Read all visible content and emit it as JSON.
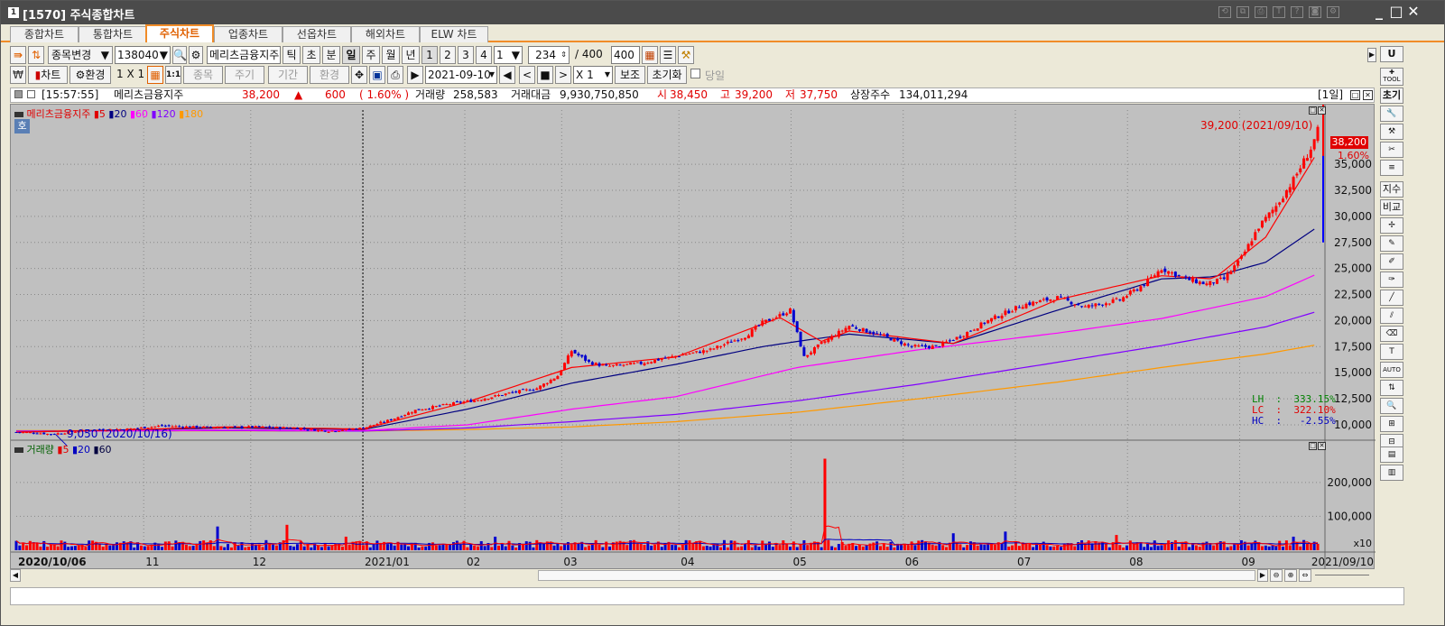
{
  "window": {
    "title": "[1570]  주식종합차트",
    "icon": "1"
  },
  "tabs": [
    "종합차트",
    "통합차트",
    "주식차트",
    "업종차트",
    "선옵차트",
    "해외차트",
    "ELW 차트"
  ],
  "active_tab": "주식차트",
  "toolbar1": {
    "stock_change": "종목변경",
    "code": "138040",
    "name": "메리츠금융지주",
    "periods": [
      "틱",
      "초",
      "분",
      "일",
      "주",
      "월",
      "년"
    ],
    "period_active": "일",
    "nums": [
      "1",
      "2",
      "3",
      "4"
    ],
    "unit_value": "1",
    "count_value": "234",
    "count_total": "/ 400",
    "count_max": "400"
  },
  "toolbar2": {
    "won": "₩",
    "chart": "차트",
    "env": "환경",
    "layout": "1 X 1",
    "stock_btn": "종목",
    "cycle_btn": "주기",
    "period_btn": "기간",
    "env2_btn": "환경",
    "date": "2021-09-10",
    "x_label": "X",
    "x_val": "1",
    "aux": "보조",
    "reset": "초기화",
    "today": "당일"
  },
  "info": {
    "time": "[15:57:55]",
    "name": "메리츠금융지주",
    "price": "38,200",
    "arrow": "▲",
    "change": "600",
    "rate": "( 1.60% )",
    "volume_label": "거래량",
    "volume": "258,583",
    "amount_label": "거래대금",
    "amount": "9,930,750,850",
    "open_label": "시",
    "open": "38,450",
    "high_label": "고",
    "high": "39,200",
    "low_label": "저",
    "low": "37,750",
    "shares_label": "상장주수",
    "shares": "134,011,294",
    "period_tag": "[1일]"
  },
  "legend_price": {
    "name": "메리츠금융지주",
    "mas": [
      "5",
      "20",
      "60",
      "120",
      "180"
    ],
    "quote_btn": "호"
  },
  "legend_volume": {
    "name": "거래량",
    "mas": [
      "5",
      "20",
      "60"
    ]
  },
  "annotations": {
    "high": "39,200 (2021/09/10)",
    "low": "9,050 (2020/10/16)",
    "cur_price": "38,200",
    "cur_rate": "1.60%",
    "lh": "LH  :  333.15%",
    "lc": "LC  :  322.10%",
    "hc": "HC  :   -2.55%"
  },
  "x_axis": [
    "2020/10/06",
    "11",
    "12",
    "2021/01",
    "02",
    "03",
    "04",
    "05",
    "06",
    "07",
    "08",
    "09",
    "2021/09/10"
  ],
  "volume_axis": [
    "200,000",
    "100,000",
    "x10"
  ],
  "colors": {
    "up": "#ff0000",
    "down": "#0000d0",
    "ma5": "#ff0000",
    "ma20": "#000080",
    "ma60": "#ff00ff",
    "ma120": "#8000ff",
    "ma180": "#ff9900",
    "bg": "#c0c0c0"
  },
  "right_tools": [
    "U",
    "TOOL",
    "초기",
    "지수",
    "비교",
    "AUTO"
  ],
  "chart_data": {
    "type": "candlestick",
    "y_ticks": [
      10000,
      12500,
      15000,
      17500,
      20000,
      22500,
      25000,
      27500,
      30000,
      32500,
      35000
    ],
    "y_tick_labels": [
      "10,000",
      "12,500",
      "15,000",
      "17,500",
      "20,000",
      "22,500",
      "25,000",
      "27,500",
      "30,000",
      "32,500",
      "35,000"
    ],
    "ylim": [
      8700,
      40200
    ],
    "volume_ylim": [
      0,
      290000
    ],
    "close_path": [
      [
        0,
        9300
      ],
      [
        5,
        9250
      ],
      [
        10,
        9100
      ],
      [
        18,
        9400
      ],
      [
        25,
        9550
      ],
      [
        32,
        9600
      ],
      [
        42,
        9900
      ],
      [
        50,
        9800
      ],
      [
        60,
        9750
      ],
      [
        68,
        9800
      ],
      [
        80,
        9700
      ],
      [
        90,
        9400
      ],
      [
        100,
        9700
      ],
      [
        108,
        10500
      ],
      [
        115,
        11400
      ],
      [
        125,
        12000
      ],
      [
        133,
        12400
      ],
      [
        143,
        13100
      ],
      [
        150,
        13500
      ],
      [
        156,
        14700
      ],
      [
        160,
        17100
      ],
      [
        165,
        16000
      ],
      [
        170,
        15600
      ],
      [
        180,
        15900
      ],
      [
        190,
        16600
      ],
      [
        200,
        17200
      ],
      [
        210,
        18500
      ],
      [
        215,
        19800
      ],
      [
        220,
        20500
      ],
      [
        223,
        21000
      ],
      [
        227,
        16500
      ],
      [
        232,
        17800
      ],
      [
        240,
        19500
      ],
      [
        250,
        18500
      ],
      [
        258,
        17500
      ],
      [
        265,
        17500
      ],
      [
        272,
        18500
      ],
      [
        280,
        20000
      ],
      [
        290,
        21500
      ],
      [
        300,
        22200
      ],
      [
        308,
        21300
      ],
      [
        318,
        22000
      ],
      [
        325,
        23500
      ],
      [
        330,
        25000
      ],
      [
        337,
        24000
      ],
      [
        343,
        23500
      ],
      [
        348,
        24000
      ],
      [
        353,
        26000
      ],
      [
        358,
        29000
      ],
      [
        363,
        31000
      ],
      [
        368,
        33500
      ],
      [
        373,
        36500
      ],
      [
        375,
        38200
      ]
    ],
    "ma5_path": [
      [
        0,
        9300
      ],
      [
        30,
        9500
      ],
      [
        60,
        9800
      ],
      [
        100,
        9600
      ],
      [
        130,
        12200
      ],
      [
        160,
        15500
      ],
      [
        190,
        16500
      ],
      [
        220,
        20300
      ],
      [
        232,
        18000
      ],
      [
        240,
        19000
      ],
      [
        270,
        17800
      ],
      [
        300,
        22000
      ],
      [
        330,
        24300
      ],
      [
        345,
        24000
      ],
      [
        360,
        28000
      ],
      [
        375,
        36200
      ]
    ],
    "ma20_path": [
      [
        0,
        9300
      ],
      [
        60,
        9700
      ],
      [
        100,
        9550
      ],
      [
        130,
        11500
      ],
      [
        160,
        14000
      ],
      [
        190,
        15800
      ],
      [
        215,
        17500
      ],
      [
        225,
        18000
      ],
      [
        240,
        18700
      ],
      [
        270,
        17800
      ],
      [
        300,
        21000
      ],
      [
        330,
        24000
      ],
      [
        345,
        24200
      ],
      [
        360,
        25600
      ],
      [
        375,
        29000
      ]
    ],
    "ma60_path": [
      [
        0,
        9350
      ],
      [
        60,
        9500
      ],
      [
        100,
        9450
      ],
      [
        130,
        10000
      ],
      [
        160,
        11500
      ],
      [
        190,
        12700
      ],
      [
        225,
        15500
      ],
      [
        260,
        17200
      ],
      [
        300,
        18800
      ],
      [
        330,
        20200
      ],
      [
        360,
        22300
      ],
      [
        375,
        24500
      ]
    ],
    "ma120_path": [
      [
        0,
        9400
      ],
      [
        60,
        9450
      ],
      [
        100,
        9400
      ],
      [
        130,
        9700
      ],
      [
        160,
        10300
      ],
      [
        190,
        11000
      ],
      [
        225,
        12300
      ],
      [
        260,
        13900
      ],
      [
        300,
        16000
      ],
      [
        330,
        17600
      ],
      [
        360,
        19400
      ],
      [
        375,
        20900
      ]
    ],
    "ma180_path": [
      [
        0,
        9450
      ],
      [
        100,
        9400
      ],
      [
        130,
        9550
      ],
      [
        160,
        9800
      ],
      [
        190,
        10300
      ],
      [
        225,
        11200
      ],
      [
        260,
        12500
      ],
      [
        300,
        14100
      ],
      [
        330,
        15500
      ],
      [
        360,
        16800
      ],
      [
        375,
        17700
      ]
    ],
    "volume_spikes": [
      [
        58,
        70000
      ],
      [
        78,
        75000
      ],
      [
        95,
        45000
      ],
      [
        95,
        40000
      ],
      [
        138,
        40000
      ],
      [
        178,
        30000
      ],
      [
        233,
        270000
      ],
      [
        270,
        50000
      ],
      [
        285,
        55000
      ],
      [
        317,
        45000
      ],
      [
        368,
        40000
      ],
      [
        371,
        30000
      ],
      [
        374,
        25000
      ]
    ]
  }
}
